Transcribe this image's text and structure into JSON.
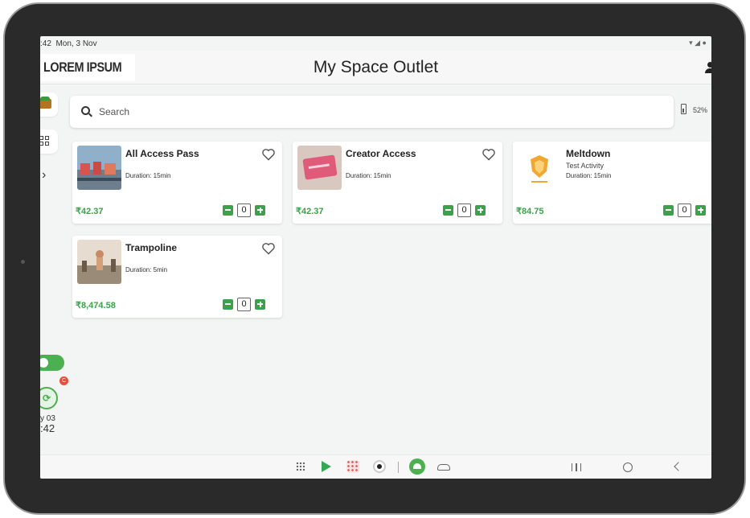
{
  "status": {
    "time": ":42",
    "date": "Mon, 3 Nov"
  },
  "header": {
    "logo_text": "LOREM IPSUM",
    "title": "My Space Outlet"
  },
  "search": {
    "placeholder": "Search",
    "value": ""
  },
  "battery": {
    "percent": "52%"
  },
  "products": [
    {
      "name": "All Access Pass",
      "subtitle": "",
      "duration": "Duration: 15min",
      "price": "₹42.37",
      "quantity": "0",
      "favorite": false
    },
    {
      "name": "Creator Access",
      "subtitle": "",
      "duration": "Duration: 15min",
      "price": "₹42.37",
      "quantity": "0",
      "favorite": false
    },
    {
      "name": "Meltdown",
      "subtitle": "Test Activity",
      "duration": "Duration: 15min",
      "price": "₹84.75",
      "quantity": "0",
      "favorite": false
    },
    {
      "name": "Trampoline",
      "subtitle": "",
      "duration": "Duration: 5min",
      "price": "₹8,474.58",
      "quantity": "0",
      "favorite": false
    }
  ],
  "rail": {
    "badge": "C",
    "clock_small": "y 03",
    "clock_big": ":42",
    "cart_icon": "cart-icon",
    "grid_icon": "grid-icon",
    "expand_icon": "chevron-right-icon"
  },
  "colors": {
    "accent": "#3ba24a",
    "brand": "#d7342b",
    "toggle": "#4caf50"
  }
}
